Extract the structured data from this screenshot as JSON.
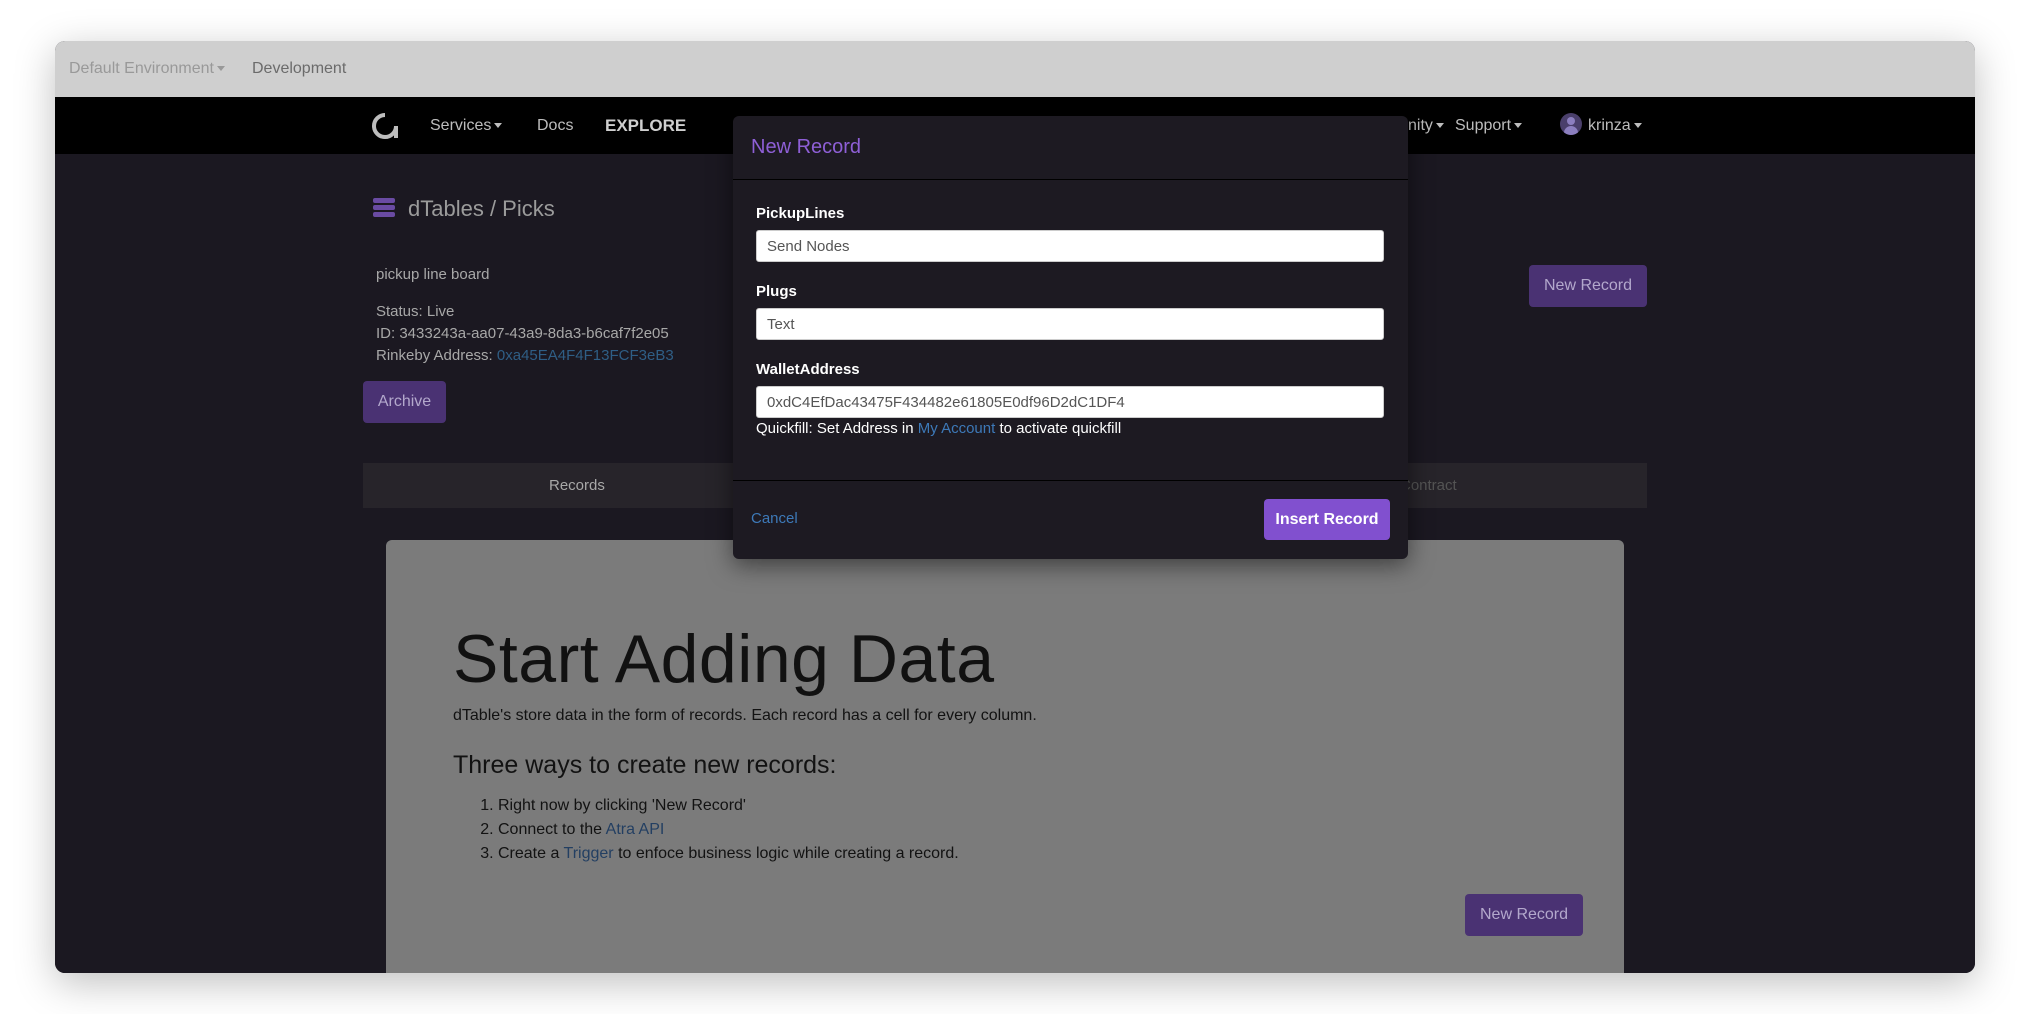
{
  "envbar": {
    "environment": "Default Environment",
    "development": "Development"
  },
  "nav": {
    "services": "Services",
    "docs": "Docs",
    "explore": "EXPLORE",
    "community": "Community",
    "support": "Support",
    "user": "krinza"
  },
  "breadcrumb": {
    "text": "dTables / Picks"
  },
  "table": {
    "description": "pickup line board",
    "status": "Status: Live",
    "id": "ID: 3433243a-aa07-43a9-8da3-b6caf7f2e05",
    "rinkeby_label": "Rinkeby Address: ",
    "rinkeby_address": "0xa45EA4F4F13FCF3eB3"
  },
  "buttons": {
    "archive": "Archive",
    "new_record": "New Record"
  },
  "tabs": {
    "records": "Records",
    "contract": "Contract"
  },
  "panel": {
    "heading": "Start Adding Data",
    "intro": "dTable's store data in the form of records. Each record has a cell for every column.",
    "subheading": "Three ways to create new records:",
    "step1": "Right now by clicking 'New Record'",
    "step2_prefix": "Connect to the ",
    "step2_link": "Atra API",
    "step3_prefix": "Create a ",
    "step3_link": "Trigger",
    "step3_suffix": " to enfoce business logic while creating a record."
  },
  "modal": {
    "title": "New Record",
    "fields": [
      {
        "label": "PickupLines",
        "value": "Send Nodes"
      },
      {
        "label": "Plugs",
        "value": "Text"
      },
      {
        "label": "WalletAddress",
        "value": "0xdC4EfDac43475F434482e61805E0df96D2dC1DF4"
      }
    ],
    "quickfill_prefix": "Quickfill: Set Address in ",
    "quickfill_link": "My Account",
    "quickfill_suffix": " to activate quickfill",
    "cancel": "Cancel",
    "insert": "Insert Record"
  },
  "colors": {
    "accent": "#8150cf",
    "link": "#3d79b8",
    "modal_bg": "#1d1a22",
    "navbar_bg": "#000000"
  }
}
